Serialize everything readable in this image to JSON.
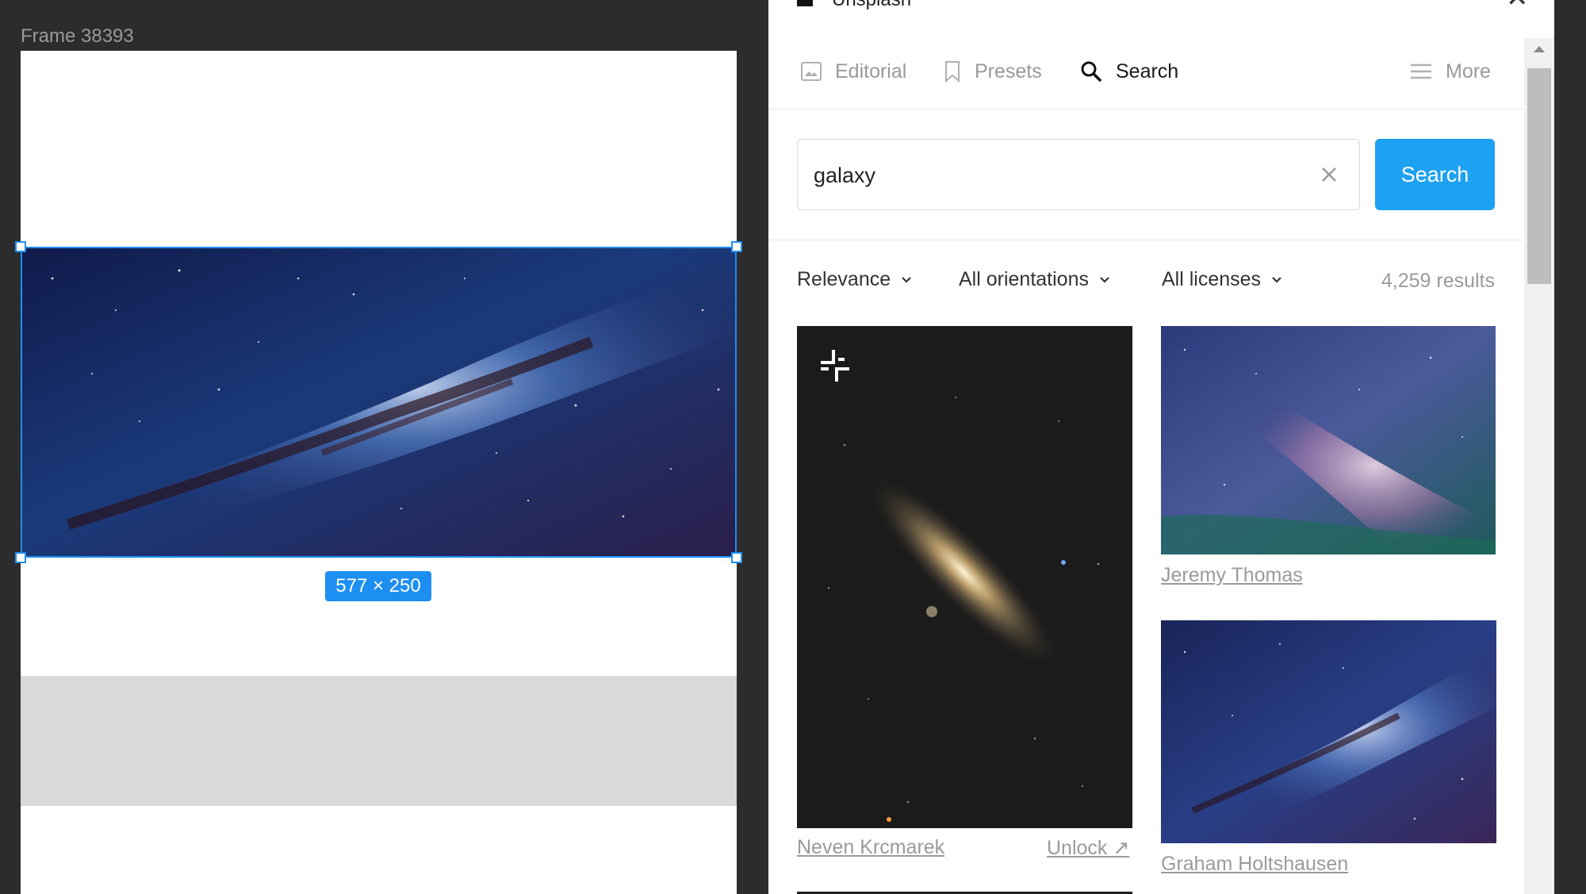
{
  "canvas": {
    "frame_label": "Frame 38393",
    "selection_size": "577 × 250"
  },
  "colors": {
    "selection": "#1d8ff3",
    "primary_button": "#1da1f2",
    "muted_text": "#9a9a9a"
  },
  "panel": {
    "title": "Unsplash",
    "tabs": [
      {
        "label": "Editorial",
        "icon": "image-icon",
        "active": false
      },
      {
        "label": "Presets",
        "icon": "bookmark-icon",
        "active": false
      },
      {
        "label": "Search",
        "icon": "search-icon",
        "active": true
      },
      {
        "label": "More",
        "icon": "menu-icon",
        "active": false
      }
    ],
    "search": {
      "value": "galaxy",
      "button_label": "Search"
    },
    "filters": {
      "sort": "Relevance",
      "orientation": "All orientations",
      "license": "All licenses",
      "results": "4,259 results"
    },
    "photos": [
      {
        "credit": "Neven Krcmarek",
        "action": "Unlock ↗",
        "premium": true
      },
      {
        "credit": "Jeremy Thomas"
      },
      {
        "credit": "Graham Holtshausen"
      }
    ]
  }
}
